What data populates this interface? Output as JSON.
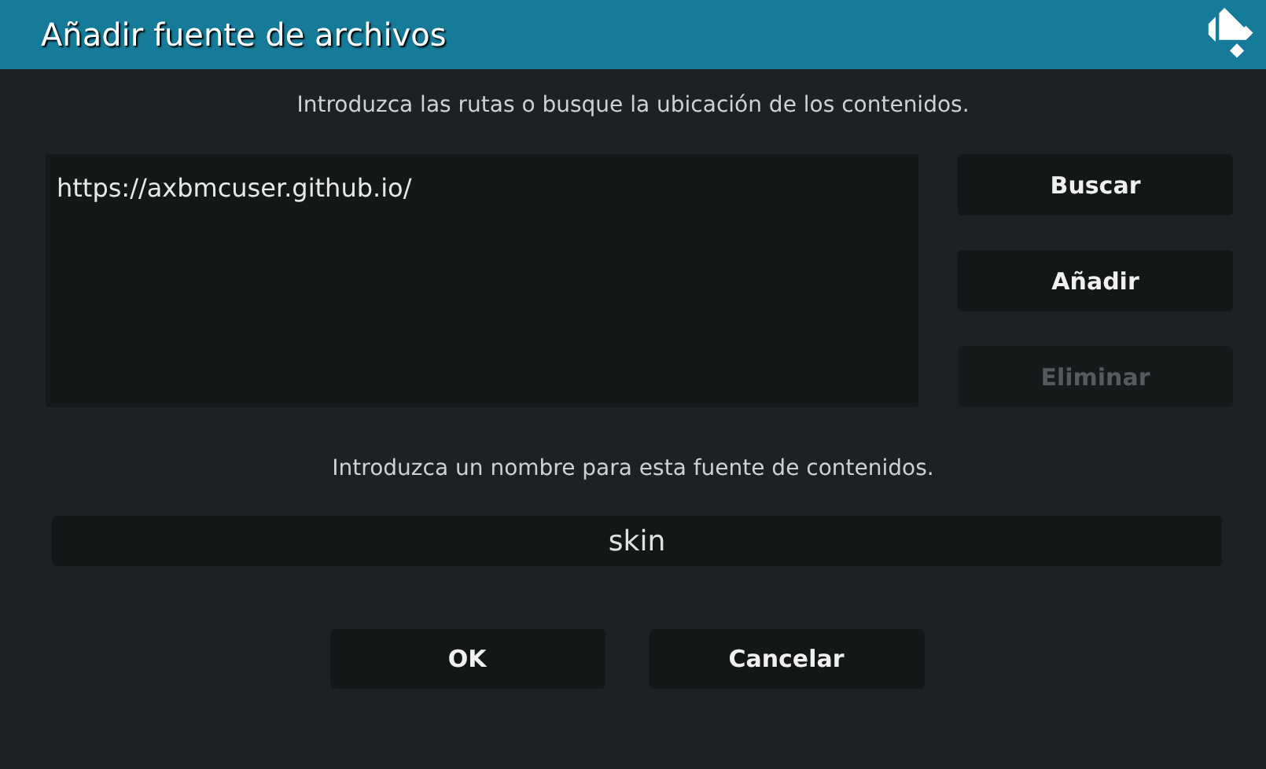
{
  "window": {
    "title": "Añadir fuente de archivos"
  },
  "paths_prompt": "Introduzca las rutas o busque la ubicación de los contenidos.",
  "paths": [
    "https://axbmcuser.github.io/"
  ],
  "path_buttons": [
    {
      "label": "Buscar",
      "disabled": false
    },
    {
      "label": "Añadir",
      "disabled": false
    },
    {
      "label": "Eliminar",
      "disabled": true
    }
  ],
  "name_prompt": "Introduzca un nombre para esta fuente de contenidos.",
  "name_field": {
    "value": "skin"
  },
  "buttons": [
    {
      "label": "OK",
      "disabled": false
    },
    {
      "label": "Cancelar",
      "disabled": false
    }
  ]
}
